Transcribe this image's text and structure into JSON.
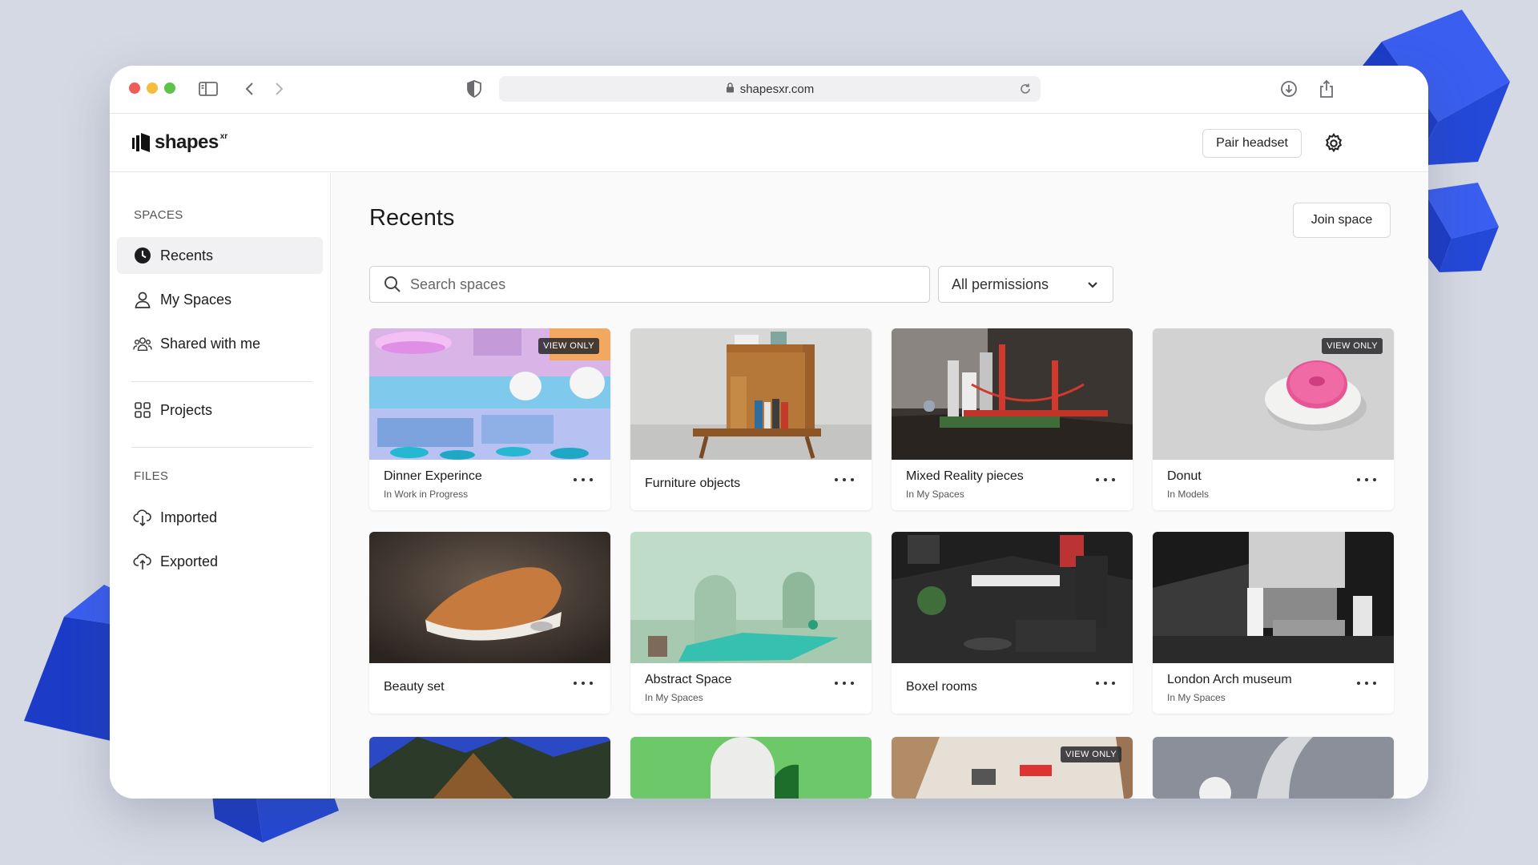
{
  "browser": {
    "url": "shapesxr.com"
  },
  "app": {
    "logo_text": "shapes",
    "logo_sup": "xr",
    "pair_headset_label": "Pair headset"
  },
  "sidebar": {
    "spaces_heading": "SPACES",
    "files_heading": "FILES",
    "items": [
      {
        "label": "Recents",
        "icon": "clock-icon"
      },
      {
        "label": "My Spaces",
        "icon": "user-icon"
      },
      {
        "label": "Shared with me",
        "icon": "group-icon"
      },
      {
        "label": "Projects",
        "icon": "grid-icon"
      },
      {
        "label": "Imported",
        "icon": "cloud-download-icon"
      },
      {
        "label": "Exported",
        "icon": "cloud-upload-icon"
      }
    ]
  },
  "main": {
    "title": "Recents",
    "join_label": "Join space",
    "search_placeholder": "Search spaces",
    "permissions_selected": "All permissions"
  },
  "badge_label": "VIEW ONLY",
  "cards": [
    {
      "title": "Dinner Experince",
      "subtitle": "In Work in Progress",
      "view_only": true
    },
    {
      "title": "Furniture objects",
      "subtitle": "",
      "view_only": false
    },
    {
      "title": "Mixed Reality pieces",
      "subtitle": "In My Spaces",
      "view_only": false
    },
    {
      "title": "Donut",
      "subtitle": "In Models",
      "view_only": true
    },
    {
      "title": "Beauty set",
      "subtitle": "",
      "view_only": false
    },
    {
      "title": "Abstract Space",
      "subtitle": "In My Spaces",
      "view_only": false
    },
    {
      "title": "Boxel rooms",
      "subtitle": "",
      "view_only": false
    },
    {
      "title": "London Arch museum",
      "subtitle": "In My Spaces",
      "view_only": false
    }
  ],
  "colors": {
    "background": "#d5d9e3",
    "cube_blue": "#2448d8",
    "badge_bg": "#28282c"
  }
}
